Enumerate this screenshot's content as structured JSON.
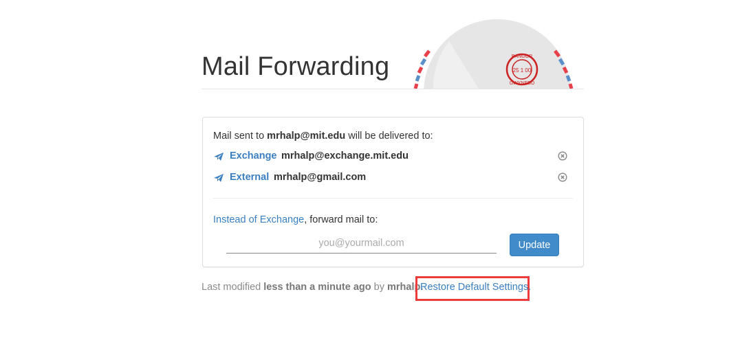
{
  "header": {
    "title": "Mail Forwarding",
    "stamp_text_top": "BANGOR",
    "stamp_date": "25 1 00",
    "stamp_text_bottom": "GWYNEDD"
  },
  "panel": {
    "delivered_prefix": "Mail sent to ",
    "delivered_email": "mrhalp@mit.edu",
    "delivered_suffix": " will be delivered to:",
    "destinations": [
      {
        "type": "Exchange",
        "address": "mrhalp@exchange.mit.edu",
        "icon": "paper-plane-icon",
        "remove_icon": "remove-icon"
      },
      {
        "type": "External",
        "address": "mrhalp@gmail.com",
        "icon": "paper-plane-icon",
        "remove_icon": "remove-icon"
      }
    ],
    "forward_link": "Instead of Exchange",
    "forward_suffix": ", forward mail to:",
    "email_placeholder": "you@yourmail.com",
    "email_value": "",
    "update_label": "Update"
  },
  "footer": {
    "prefix": "Last modified ",
    "when": "less than a minute ago",
    "by": " by ",
    "user": "mrhalp.",
    "restore_label": "Restore Default Settings."
  },
  "colors": {
    "link": "#3a7fc1",
    "button": "#428bca",
    "highlight": "#ee3b3b",
    "stamp": "#cc2222",
    "airmail_red": "#e8404a",
    "airmail_blue": "#5a8fc8"
  }
}
